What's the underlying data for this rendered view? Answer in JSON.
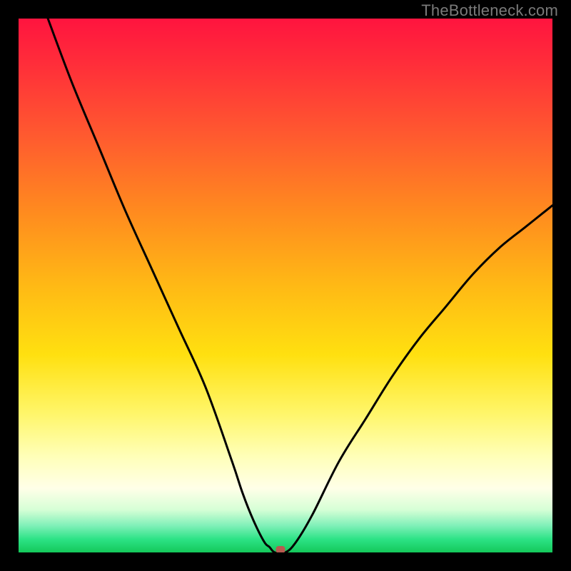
{
  "watermark": "TheBottleneck.com",
  "chart_data": {
    "type": "line",
    "title": "",
    "xlabel": "",
    "ylabel": "",
    "xlim": [
      0,
      100
    ],
    "ylim": [
      0,
      100
    ],
    "grid": false,
    "legend": false,
    "series": [
      {
        "name": "bottleneck-curve",
        "x": [
          5.5,
          10,
          15,
          20,
          25,
          30,
          35,
          40,
          42,
          44,
          46,
          47,
          48,
          50,
          52,
          55,
          60,
          65,
          70,
          75,
          80,
          85,
          90,
          95,
          100
        ],
        "values": [
          100,
          88,
          76,
          64,
          53,
          42,
          31,
          17,
          11,
          6,
          2,
          1,
          0,
          0,
          2,
          7,
          17,
          25,
          33,
          40,
          46,
          52,
          57,
          61,
          65
        ]
      }
    ],
    "minimum_marker": {
      "x": 49,
      "y": 0
    },
    "background_gradient": {
      "stops": [
        {
          "pos": 0.0,
          "color": "#ff143f"
        },
        {
          "pos": 0.22,
          "color": "#ff5a2f"
        },
        {
          "pos": 0.5,
          "color": "#ffb915"
        },
        {
          "pos": 0.74,
          "color": "#fff66a"
        },
        {
          "pos": 0.88,
          "color": "#ffffe8"
        },
        {
          "pos": 0.95,
          "color": "#7ff0b8"
        },
        {
          "pos": 1.0,
          "color": "#14c85a"
        }
      ]
    }
  }
}
